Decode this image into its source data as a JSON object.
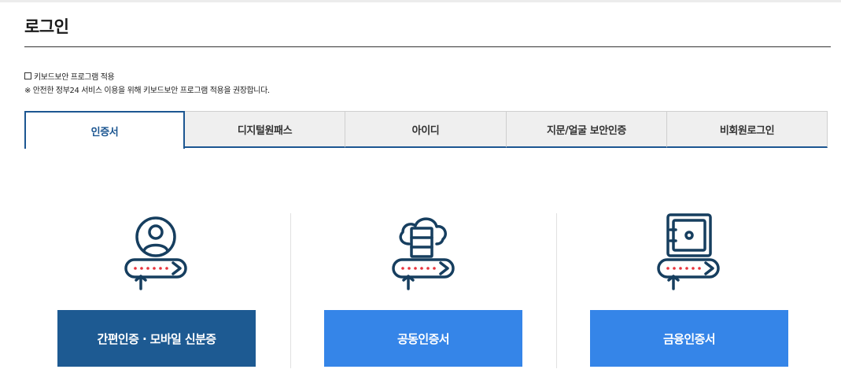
{
  "page": {
    "title": "로그인"
  },
  "keyboard_security": {
    "checkbox_label": "키보드보안 프로그램 적용",
    "notice": "※ 안전한 정부24 서비스 이용을 위해 키보드보안 프로그램 적용을 권장합니다."
  },
  "tabs": [
    {
      "label": "인증서",
      "active": true
    },
    {
      "label": "디지털원패스"
    },
    {
      "label": "아이디"
    },
    {
      "label": "지문/얼굴 보안인증"
    },
    {
      "label": "비회원로그인"
    }
  ],
  "cert_options": [
    {
      "label": "간편인증 · 모바일 신분증",
      "color": "#1d5a92",
      "icon": "person-id-icon"
    },
    {
      "label": "공동인증서",
      "color": "#3585e8",
      "icon": "cloud-server-icon"
    },
    {
      "label": "금융인증서",
      "color": "#3585e8",
      "icon": "safe-vault-icon"
    }
  ],
  "colors": {
    "navy": "#163e5f",
    "accent_red": "#e8323c",
    "active_tab": "#1c5691"
  }
}
